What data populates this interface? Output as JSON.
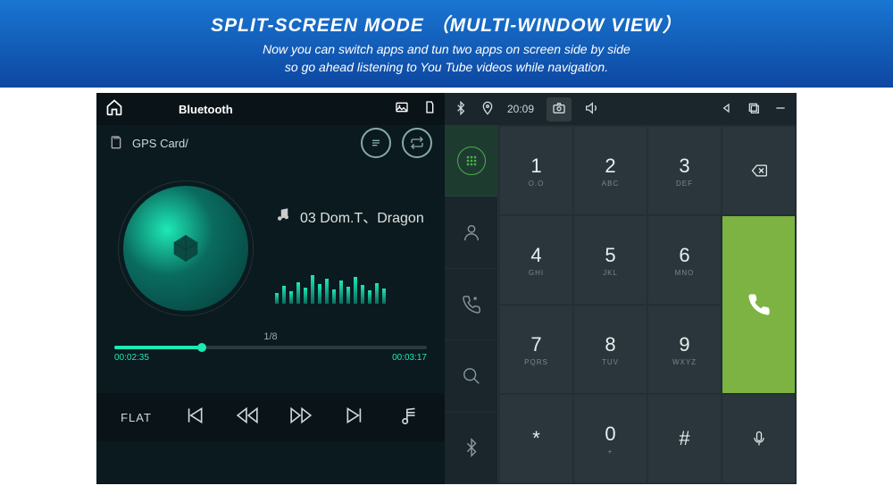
{
  "banner": {
    "title": "SPLIT-SCREEN MODE （MULTI-WINDOW VIEW）",
    "line1": "Now you can switch apps and tun two apps on screen side by side",
    "line2": "so go ahead listening to You Tube videos while navigation."
  },
  "player": {
    "header_title": "Bluetooth",
    "source_path": "GPS Card/",
    "track_label": "03 Dom.T、Dragon",
    "counter": "1/8",
    "time_cur": "00:02:35",
    "time_total": "00:03:17",
    "eq_mode": "FLAT"
  },
  "status": {
    "time": "20:09"
  },
  "keys": [
    {
      "num": "1",
      "let": "O.O"
    },
    {
      "num": "2",
      "let": "ABC"
    },
    {
      "num": "3",
      "let": "DEF"
    },
    {
      "num": "4",
      "let": "GHI"
    },
    {
      "num": "5",
      "let": "JKL"
    },
    {
      "num": "6",
      "let": "MNO"
    },
    {
      "num": "7",
      "let": "PQRS"
    },
    {
      "num": "8",
      "let": "TUV"
    },
    {
      "num": "9",
      "let": "WXYZ"
    },
    {
      "num": "*",
      "let": ""
    },
    {
      "num": "0",
      "let": "+"
    },
    {
      "num": "#",
      "let": ""
    }
  ]
}
